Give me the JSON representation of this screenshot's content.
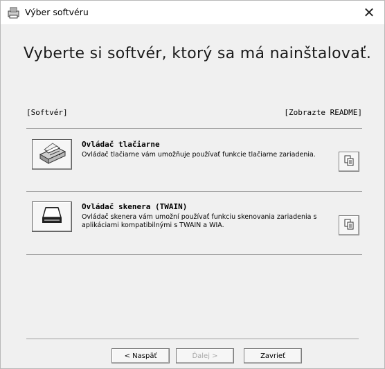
{
  "window": {
    "title": "Výber softvéru",
    "close_glyph": "✕"
  },
  "main": {
    "heading": "Vyberte si softvér, ktorý sa má nainštalovať.",
    "section_label": "[Softvér]",
    "readme_label": "[Zobrazte README]"
  },
  "items": [
    {
      "title": "Ovládač tlačiarne",
      "description": "Ovládač tlačiarne vám umožňuje používať funkcie tlačiarne zariadenia.",
      "icon": "printer-icon",
      "readme_icon": "document-copy-icon"
    },
    {
      "title": "Ovládač skenera (TWAIN)",
      "description": "Ovládač skenera vám umožní používať funkciu skenovania zariadenia s aplikáciami kompatibilnými s TWAIN a WIA.",
      "icon": "scanner-icon",
      "readme_icon": "document-copy-icon"
    }
  ],
  "footer": {
    "back_label": "< Naspäť",
    "next_label": "Ďalej >",
    "close_label": "Zavrieť"
  }
}
